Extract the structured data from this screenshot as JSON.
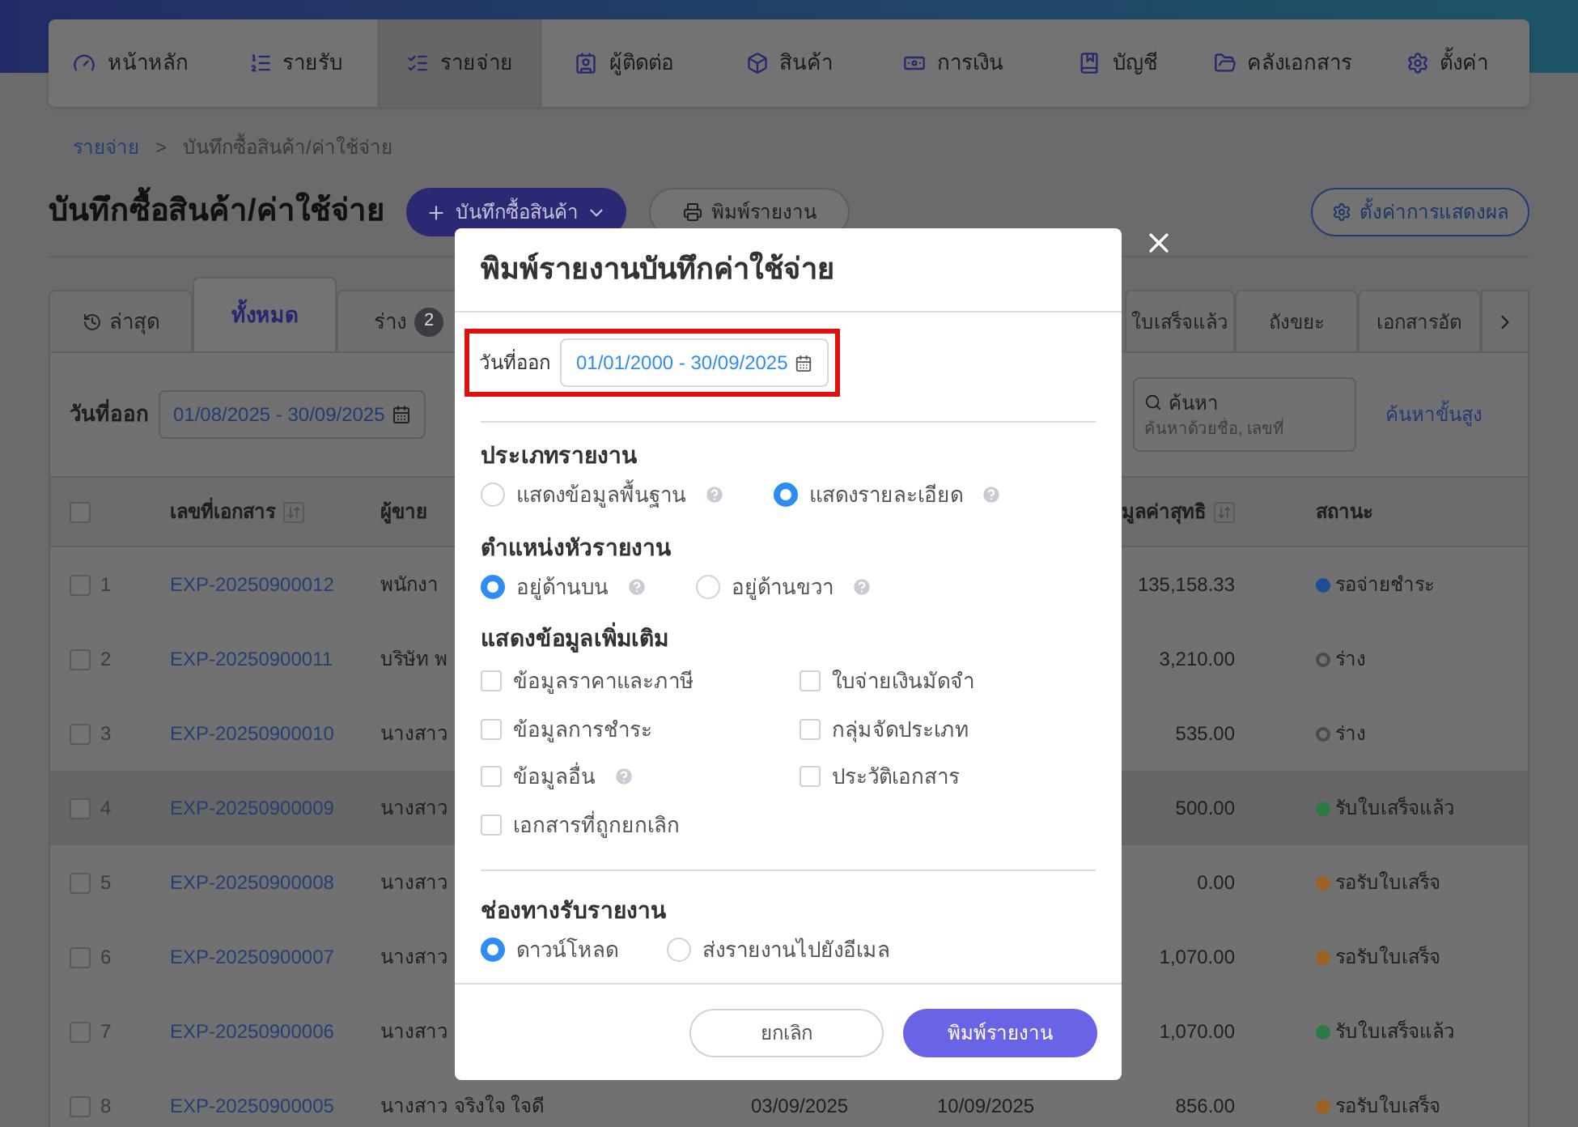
{
  "nav": [
    {
      "label": "หน้าหลัก",
      "selected": false
    },
    {
      "label": "รายรับ",
      "selected": false
    },
    {
      "label": "รายจ่าย",
      "selected": true
    },
    {
      "label": "ผู้ติดต่อ",
      "selected": false
    },
    {
      "label": "สินค้า",
      "selected": false
    },
    {
      "label": "การเงิน",
      "selected": false
    },
    {
      "label": "บัญชี",
      "selected": false
    },
    {
      "label": "คลังเอกสาร",
      "selected": false
    },
    {
      "label": "ตั้งค่า",
      "selected": false
    }
  ],
  "breadcrumb": {
    "parent": "รายจ่าย",
    "separator": ">",
    "current": "บันทึกซื้อสินค้า/ค่าใช้จ่าย"
  },
  "page_title": "บันทึกซื้อสินค้า/ค่าใช้จ่าย",
  "actions": {
    "create": "บันทึกซื้อสินค้า",
    "print": "พิมพ์รายงาน",
    "display_settings": "ตั้งค่าการแสดงผล"
  },
  "tabs_left": [
    {
      "label": "ล่าสุด",
      "selected": false
    },
    {
      "label": "ทั้งหมด",
      "selected": true
    },
    {
      "label": "ร่าง",
      "badge": "2",
      "selected": false
    }
  ],
  "tabs_right": [
    {
      "label": "ใบเสร็จแล้ว",
      "selected": false
    },
    {
      "label": "ถังขยะ",
      "selected": false
    },
    {
      "label": "เอกสารอัต",
      "selected": false
    }
  ],
  "filter": {
    "date_label": "วันที่ออก",
    "date_range": "01/08/2025 - 30/09/2025",
    "search_label": "ค้นหา",
    "search_placeholder": "ค้นหาด้วยชื่อ, เลขที่",
    "advanced_search": "ค้นหาขั้นสูง"
  },
  "table": {
    "select_all_checked": false,
    "columns": [
      {
        "label": "เลขที่เอกสาร",
        "sortable": true
      },
      {
        "label": "ผู้ขาย",
        "sortable": false
      },
      {
        "label": "มูลค่าสุทธิ",
        "sortable": true
      },
      {
        "label": "สถานะ",
        "sortable": false
      }
    ],
    "rows": [
      {
        "no": "1",
        "doc": "EXP-20250900012",
        "seller": "พนักงา",
        "net": "135,158.33",
        "status": "รอจ่ายชำระ",
        "kind": "dot",
        "color": "#1d4e94",
        "checked": false,
        "hovered": false
      },
      {
        "no": "2",
        "doc": "EXP-20250900011",
        "seller": "บริษัท พ",
        "net": "3,210.00",
        "status": "ร่าง",
        "kind": "ring",
        "color": "#4a4a4c",
        "checked": false,
        "hovered": false
      },
      {
        "no": "3",
        "doc": "EXP-20250900010",
        "seller": "นางสาว",
        "net": "535.00",
        "status": "ร่าง",
        "kind": "ring",
        "color": "#4a4a4c",
        "checked": false,
        "hovered": false
      },
      {
        "no": "4",
        "doc": "EXP-20250900009",
        "seller": "นางสาว",
        "net": "500.00",
        "status": "รับใบเสร็จแล้ว",
        "kind": "dot",
        "color": "#2a7a44",
        "checked": false,
        "hovered": true
      },
      {
        "no": "5",
        "doc": "EXP-20250900008",
        "seller": "นางสาว",
        "net": "0.00",
        "status": "รอรับใบเสร็จ",
        "kind": "dot",
        "color": "#9a6224",
        "checked": false,
        "hovered": false
      },
      {
        "no": "6",
        "doc": "EXP-20250900007",
        "seller": "นางสาว",
        "net": "1,070.00",
        "status": "รอรับใบเสร็จ",
        "kind": "dot",
        "color": "#9a6224",
        "checked": false,
        "hovered": false
      },
      {
        "no": "7",
        "doc": "EXP-20250900006",
        "seller": "นางสาว",
        "net": "1,070.00",
        "status": "รับใบเสร็จแล้ว",
        "kind": "dot",
        "color": "#2a7a44",
        "checked": false,
        "hovered": false
      },
      {
        "no": "8",
        "doc": "EXP-20250900005",
        "seller": "นางสาว จริงใจ ใจดี",
        "issue_date": "03/09/2025",
        "due_date": "10/09/2025",
        "net": "856.00",
        "status": "รอรับใบเสร็จ",
        "kind": "dot",
        "color": "#9a6224",
        "checked": false,
        "hovered": false
      }
    ]
  },
  "print_dialog": {
    "title": "พิมพ์รายงานบันทึกค่าใช้จ่าย",
    "date_label": "วันที่ออก",
    "date_range": "01/01/2000 - 30/09/2025",
    "highlighted": true,
    "sections": [
      {
        "kind": "radio",
        "title": "ประเภทรายงาน",
        "divider_before": false,
        "options": [
          {
            "label": "แสดงข้อมูลพื้นฐาน",
            "help": true,
            "selected": false
          },
          {
            "label": "แสดงรายละเอียด",
            "help": true,
            "selected": true
          }
        ]
      },
      {
        "kind": "radio",
        "title": "ตำแหน่งหัวรายงาน",
        "divider_before": false,
        "options": [
          {
            "label": "อยู่ด้านบน",
            "help": true,
            "selected": true
          },
          {
            "label": "อยู่ด้านขวา",
            "help": true,
            "selected": false
          }
        ]
      },
      {
        "kind": "checkbox",
        "title": "แสดงข้อมูลเพิ่มเติม",
        "divider_before": false,
        "options": [
          {
            "label": "ข้อมูลราคาและภาษี",
            "help": false,
            "checked": false
          },
          {
            "label": "ใบจ่ายเงินมัดจำ",
            "help": false,
            "checked": false
          },
          {
            "label": "ข้อมูลการชำระ",
            "help": false,
            "checked": false
          },
          {
            "label": "กลุ่มจัดประเภท",
            "help": false,
            "checked": false
          },
          {
            "label": "ข้อมูลอื่น",
            "help": true,
            "checked": false
          },
          {
            "label": "ประวัติเอกสาร",
            "help": false,
            "checked": false
          },
          {
            "label": "เอกสารที่ถูกยกเลิก",
            "help": false,
            "checked": false
          }
        ]
      },
      {
        "kind": "radio",
        "title": "ช่องทางรับรายงาน",
        "divider_before": true,
        "options": [
          {
            "label": "ดาวน์โหลด",
            "help": false,
            "selected": true
          },
          {
            "label": "ส่งรายงานไปยังอีเมล",
            "help": false,
            "selected": false
          }
        ]
      }
    ],
    "cancel": "ยกเลิก",
    "submit": "พิมพ์รายงาน"
  }
}
